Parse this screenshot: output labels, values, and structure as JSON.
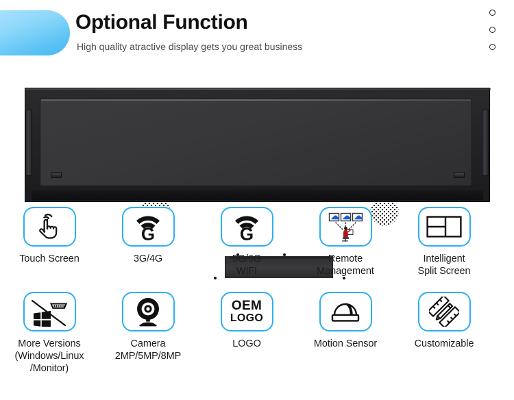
{
  "header": {
    "title": "Optional Function",
    "subtitle": "High quality atractive display gets you great business",
    "dots": [
      "dot-1",
      "dot-2",
      "dot-3"
    ],
    "accent_color": "#2cb0f0",
    "blob_color_from": "#a9e2fb",
    "blob_color_to": "#44b8f2"
  },
  "product": {
    "name": "stretched-bar-lcd-display-rear-view",
    "body_color": "#2b2b2d",
    "panel_color": "#3b3b3e",
    "speakers": 2,
    "screw_holes": 8
  },
  "features": {
    "rows": [
      [
        {
          "icon": "touch-hand-icon",
          "label": "Touch Screen"
        },
        {
          "icon": "wifi-3g4g-icon",
          "label": "3G/4G"
        },
        {
          "icon": "wifi-5g6g-icon",
          "label": "5G/6G\nWIFI"
        },
        {
          "icon": "remote-management-icon",
          "label": "Remote\nManagement"
        },
        {
          "icon": "split-screen-icon",
          "label": "Intelligent\nSplit Screen"
        }
      ],
      [
        {
          "icon": "os-versions-hdmi-icon",
          "label": "More Versions\n(Windows/Linux\n/Monitor)"
        },
        {
          "icon": "webcam-icon",
          "label": "Camera\n2MP/5MP/8MP"
        },
        {
          "icon": "oem-logo-icon",
          "label": "LOGO"
        },
        {
          "icon": "motion-sensor-icon",
          "label": "Motion Sensor"
        },
        {
          "icon": "pencil-ruler-icon",
          "label": "Customizable"
        }
      ]
    ],
    "oem_logo_text": {
      "line1": "OEM",
      "line2": "LOGO"
    }
  }
}
